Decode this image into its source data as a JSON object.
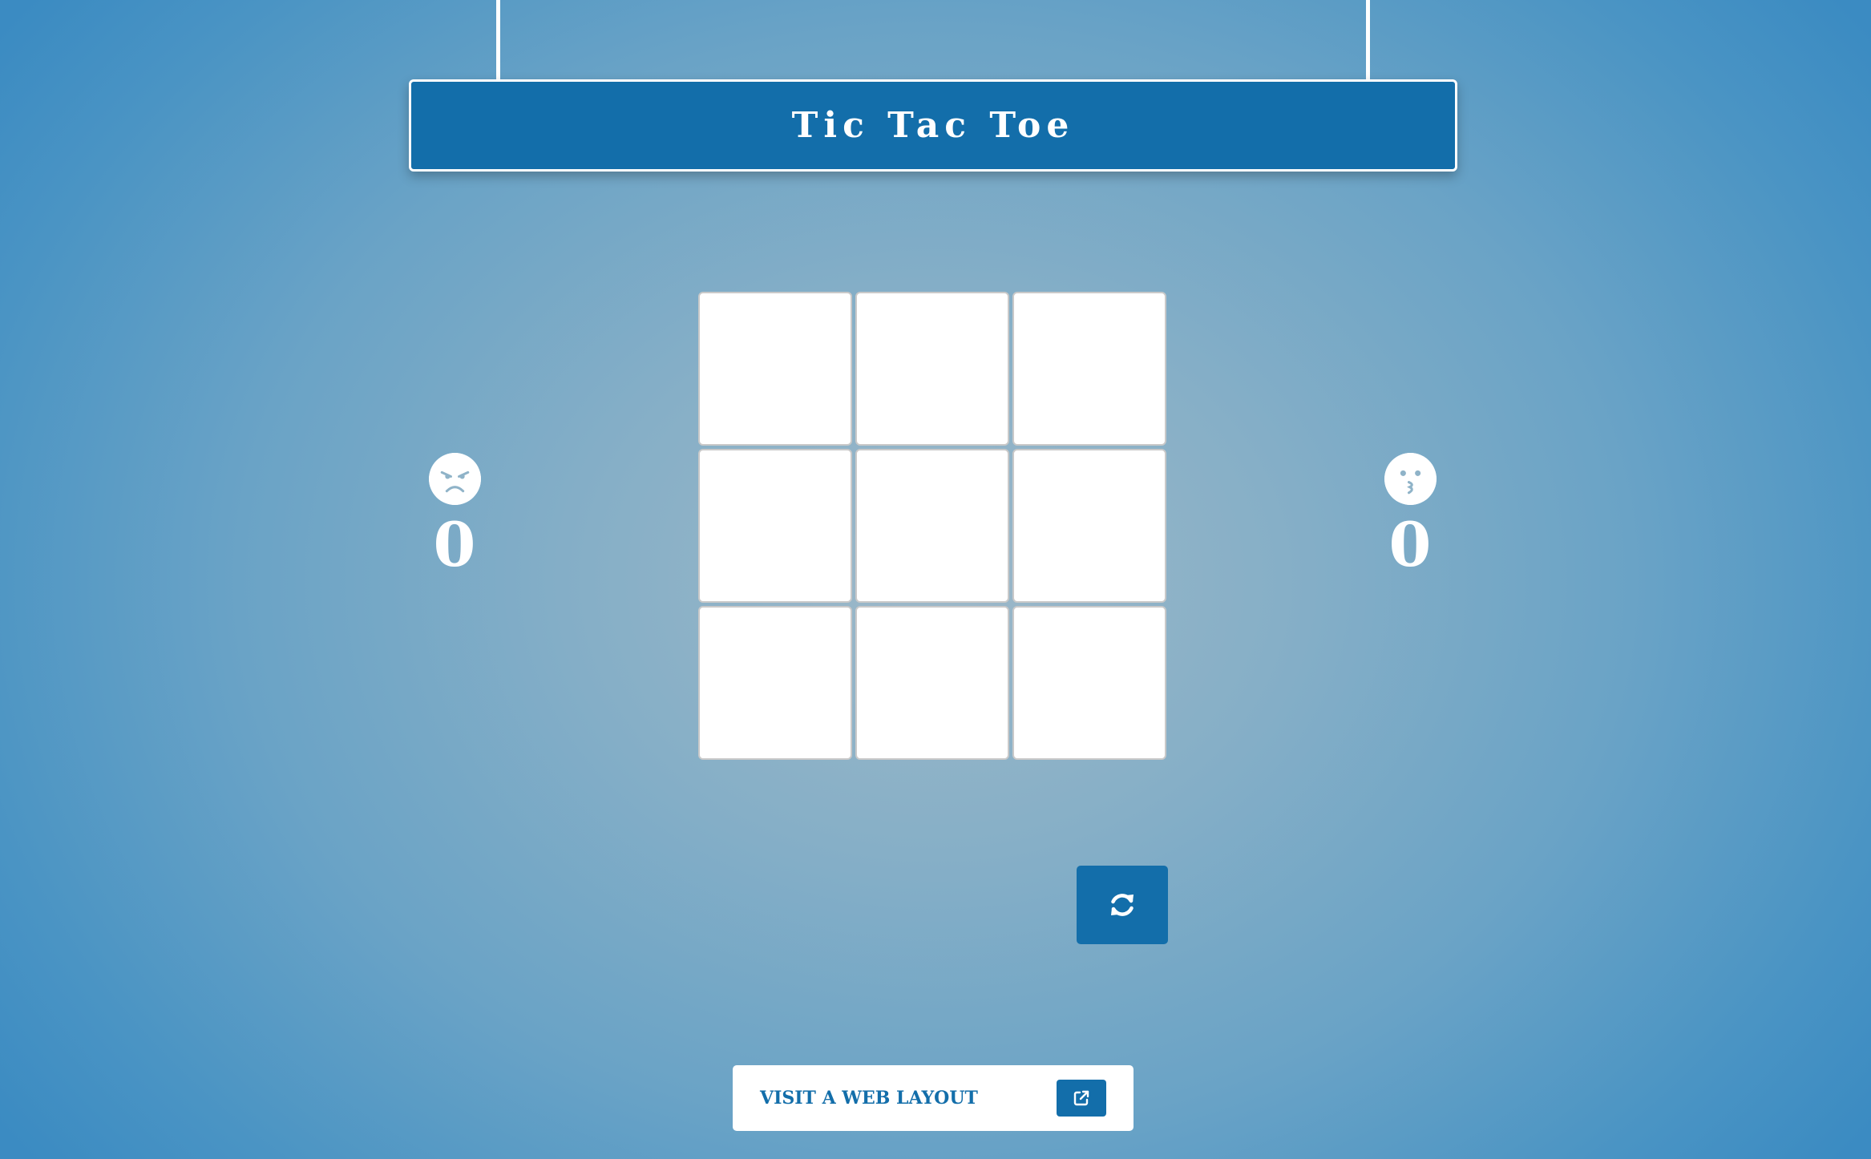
{
  "header": {
    "title": "Tic Tac Toe"
  },
  "players": [
    {
      "icon": "angry-face-icon",
      "score": "0"
    },
    {
      "icon": "kissing-face-icon",
      "score": "0"
    }
  ],
  "board": {
    "cells": [
      "",
      "",
      "",
      "",
      "",
      "",
      "",
      "",
      ""
    ]
  },
  "controls": {
    "reset_icon": "refresh-icon"
  },
  "footer": {
    "visit_label": "VISIT A WEB LAYOUT",
    "visit_icon": "external-link-icon"
  },
  "colors": {
    "primary": "#136eaa",
    "background_center": "#9db8c8",
    "background_edge": "#3b8bc2",
    "face_feature": "#8fb3c8"
  }
}
